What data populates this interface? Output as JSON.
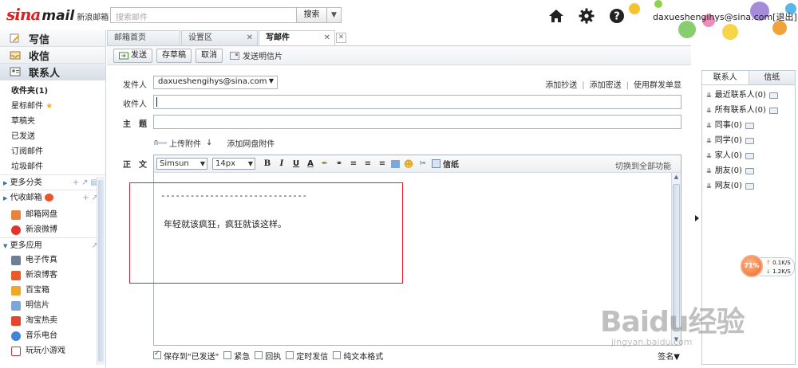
{
  "brand": {
    "logo_sina": "sina",
    "logo_mail": "mail",
    "logo_cn": "新浪邮箱"
  },
  "search": {
    "placeholder": "搜索邮件",
    "button": "搜索"
  },
  "account": {
    "email": "daxueshengihys@sina.com",
    "logout": "[退出]"
  },
  "icons": {
    "home": "home-icon",
    "settings": "gear-icon",
    "help": "help-icon"
  },
  "sidebar": {
    "compose": "写信",
    "inbox": "收信",
    "contacts": "联系人",
    "folders": [
      "收件夹(1)",
      "星标邮件",
      "草稿夹",
      "已发送",
      "订阅邮件",
      "垃圾邮件"
    ],
    "more_categories": "更多分类",
    "proxy_mailbox": "代收邮箱",
    "apps_top": [
      "邮箱网盘",
      "新浪微博"
    ],
    "more_apps": "更多应用",
    "apps": [
      "电子传真",
      "新浪博客",
      "百宝箱",
      "明信片",
      "淘宝热卖",
      "音乐电台",
      "玩玩小游戏"
    ]
  },
  "tabs": [
    {
      "label": "邮箱首页"
    },
    {
      "label": "设置区"
    },
    {
      "label": "写邮件"
    }
  ],
  "toolbar": {
    "send": "发送",
    "save_draft": "存草稿",
    "cancel": "取消",
    "send_postcard": "发送明信片"
  },
  "compose": {
    "from_label": "发件人",
    "from_value": "daxueshengihys@sina.com",
    "add_cc": "添加抄送",
    "add_bcc": "添加密送",
    "group_send": "使用群发单显",
    "to_label": "收件人",
    "subject_label": "主　题",
    "upload_attachment": "上传附件",
    "add_cloud_attachment": "添加网盘附件",
    "body_label": "正　文",
    "font_family": "Simsun",
    "font_size": "14px",
    "stationery": "信纸",
    "switch_full": "切换到全部功能",
    "body_dashes": "------------------------------",
    "body_text": "年轻就该疯狂，疯狂就该这样。",
    "opt_save_sent": "保存到\"已发送\"",
    "opt_urgent": "紧急",
    "opt_receipt": "回执",
    "opt_scheduled": "定时发信",
    "opt_plain": "纯文本格式",
    "signature": "签名"
  },
  "right_panel": {
    "tab_contacts": "联系人",
    "tab_stationery": "信纸",
    "groups": [
      "最近联系人(0)",
      "所有联系人(0)",
      "同事(0)",
      "同学(0)",
      "家人(0)",
      "朋友(0)",
      "网友(0)"
    ]
  },
  "speed": {
    "percent": "71%",
    "up": "0.1K/S",
    "down": "1.2K/S"
  },
  "watermark": {
    "big": "Baidu经验",
    "small": "jingyan.baidu.com"
  },
  "colors": {
    "accent_red": "#e0202a",
    "panel_border": "#c4ccd6"
  }
}
